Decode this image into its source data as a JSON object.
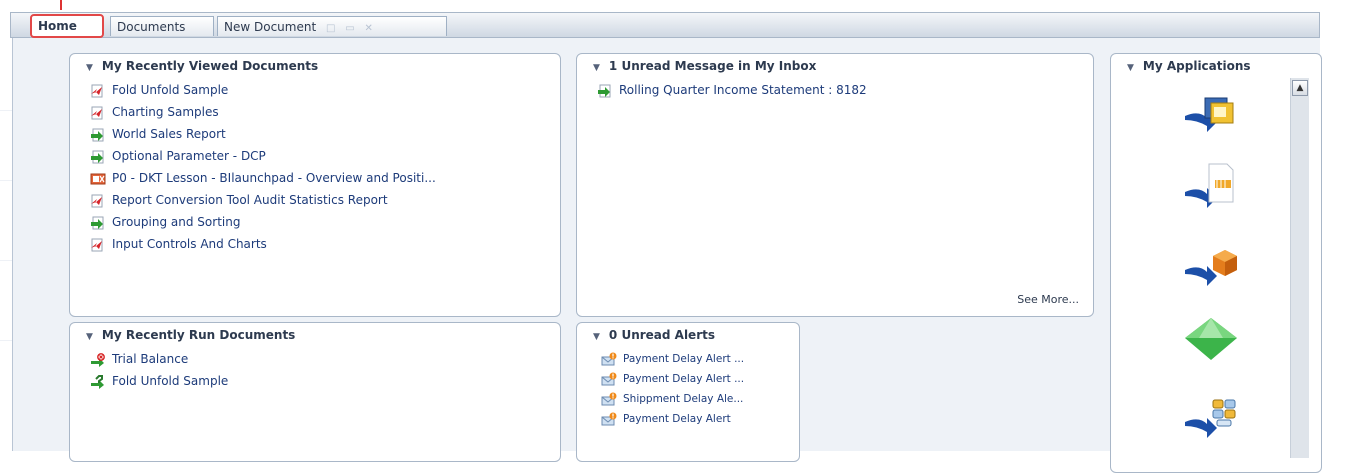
{
  "tabs": {
    "home": "Home",
    "documents": "Documents",
    "new_document": "New Document"
  },
  "panels": {
    "recent_viewed": {
      "title": "My Recently Viewed Documents",
      "items": [
        {
          "label": "Fold Unfold Sample",
          "icon": "webi-doc-icon"
        },
        {
          "label": "Charting Samples",
          "icon": "webi-doc-icon"
        },
        {
          "label": "World Sales Report",
          "icon": "crystal-report-icon"
        },
        {
          "label": "Optional Parameter - DCP",
          "icon": "crystal-report-icon"
        },
        {
          "label": "P0 - DKT Lesson - BIlaunchpad - Overview and Positi...",
          "icon": "powerpoint-icon"
        },
        {
          "label": "Report Conversion Tool Audit Statistics Report",
          "icon": "webi-doc-icon"
        },
        {
          "label": "Grouping and Sorting",
          "icon": "crystal-report-icon"
        },
        {
          "label": "Input Controls And Charts",
          "icon": "webi-doc-icon"
        }
      ]
    },
    "inbox": {
      "title": "1 Unread Message in My Inbox",
      "items": [
        {
          "label": "Rolling Quarter Income Statement : 8182",
          "icon": "crystal-report-icon"
        }
      ],
      "see_more": "See More..."
    },
    "recent_run": {
      "title": "My Recently Run Documents",
      "items": [
        {
          "label": "Trial Balance",
          "icon": "failed-instance-icon"
        },
        {
          "label": "Fold Unfold Sample",
          "icon": "success-instance-icon"
        }
      ]
    },
    "alerts": {
      "title": "0 Unread Alerts",
      "items": [
        {
          "label": "Payment Delay Alert ...",
          "icon": "alert-icon"
        },
        {
          "label": "Payment Delay Alert ...",
          "icon": "alert-icon"
        },
        {
          "label": "Shippment Delay Ale...",
          "icon": "alert-icon"
        },
        {
          "label": "Payment Delay Alert",
          "icon": "alert-icon"
        }
      ]
    },
    "applications": {
      "title": "My Applications",
      "items": [
        {
          "icon": "cmc-app-icon"
        },
        {
          "icon": "crystal-reports-app-icon"
        },
        {
          "icon": "universe-app-icon"
        },
        {
          "icon": "diamond-app-icon"
        },
        {
          "icon": "dashboard-app-icon"
        }
      ]
    }
  },
  "colors": {
    "accent_red": "#e24848",
    "link_blue": "#1d3b7a",
    "frame_bg": "#eef2f7"
  }
}
